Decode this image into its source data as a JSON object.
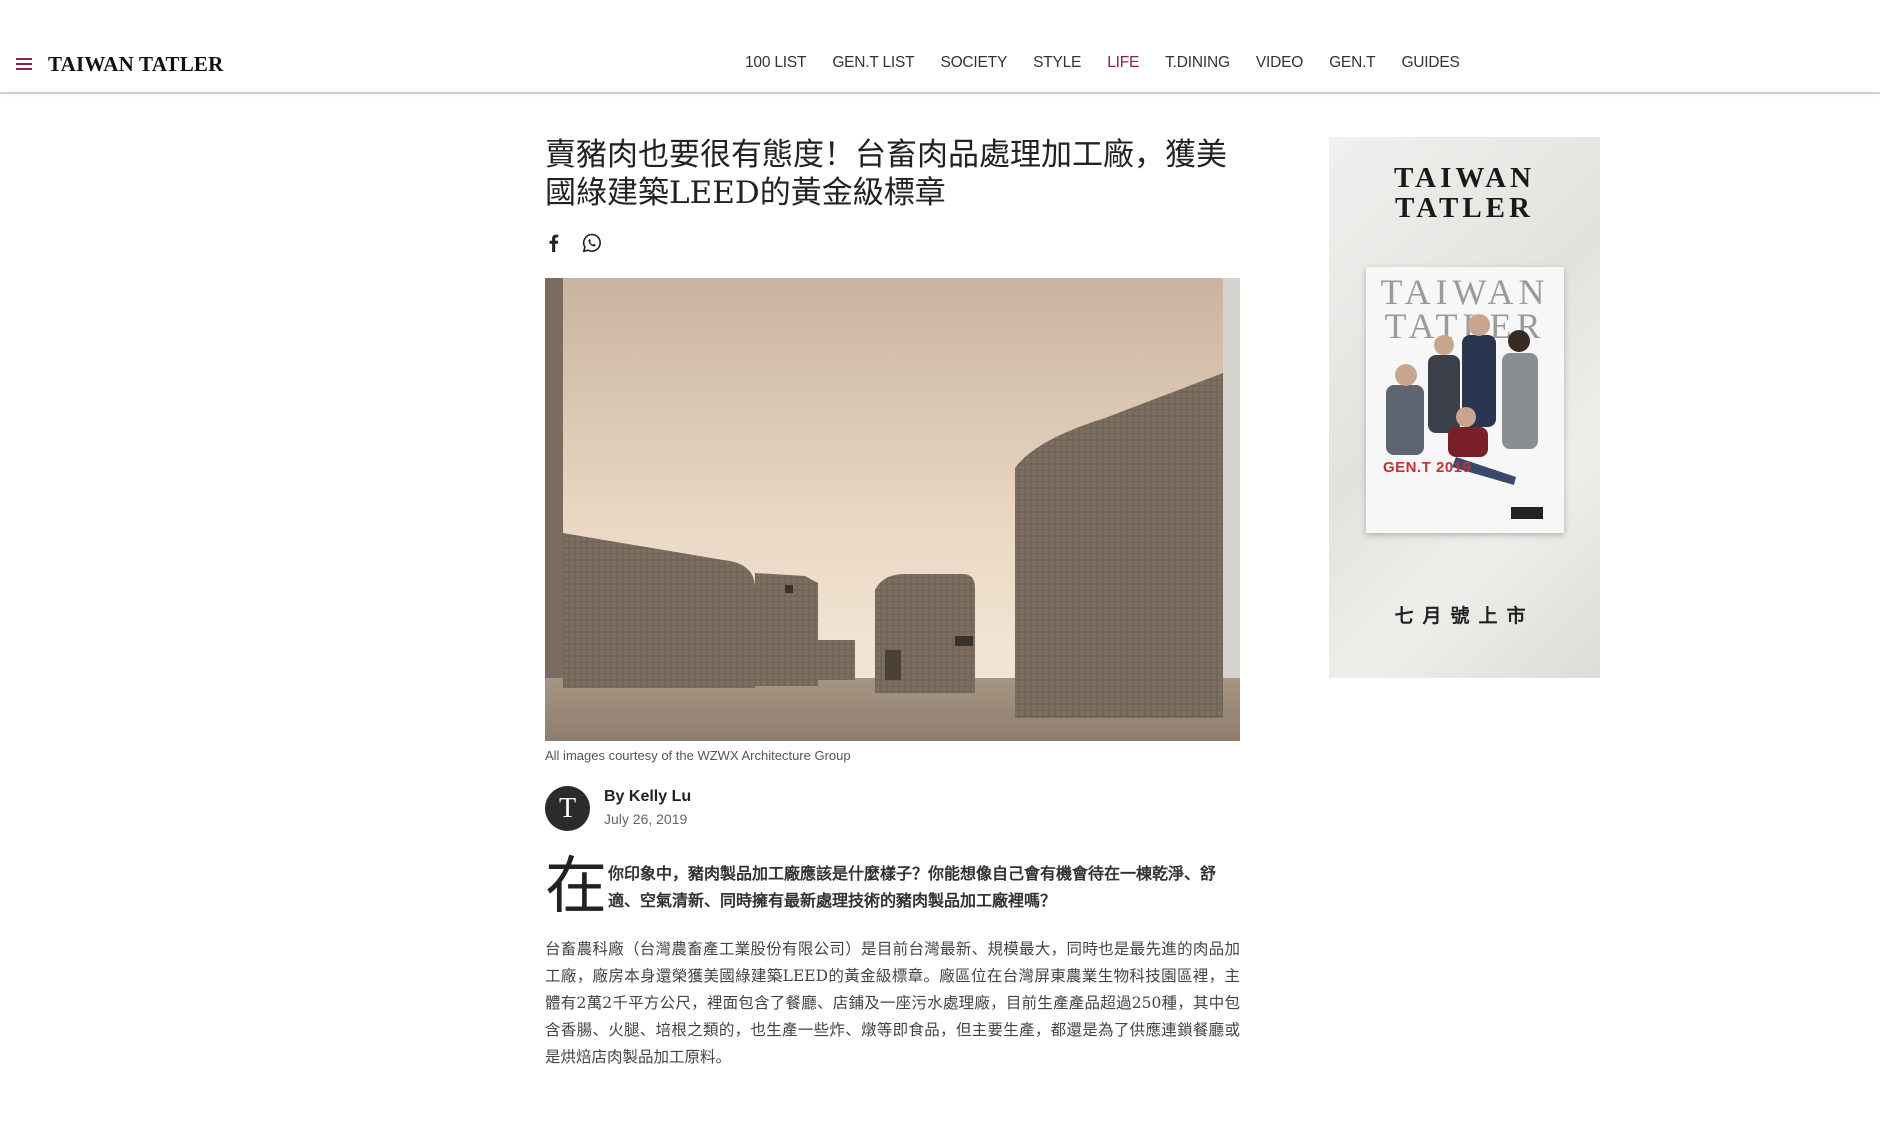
{
  "header": {
    "brand": "TAIWAN TATLER",
    "menu_icon": "hamburger-menu-icon",
    "accent_color": "#8b2140",
    "nav": [
      {
        "label": "100 LIST",
        "active": false
      },
      {
        "label": "GEN.T LIST",
        "active": false
      },
      {
        "label": "SOCIETY",
        "active": false
      },
      {
        "label": "STYLE",
        "active": false
      },
      {
        "label": "LIFE",
        "active": true
      },
      {
        "label": "T.DINING",
        "active": false
      },
      {
        "label": "VIDEO",
        "active": false
      },
      {
        "label": "GEN.T",
        "active": false
      },
      {
        "label": "GUIDES",
        "active": false
      }
    ]
  },
  "article": {
    "title": "賣豬肉也要很有態度！台畜肉品處理加工廠，獲美國綠建築LEED的黃金級標章",
    "share": {
      "facebook_icon": "facebook-icon",
      "whatsapp_icon": "whatsapp-icon"
    },
    "image_caption": "All images courtesy of the WZWX Architecture Group",
    "author": {
      "avatar_letter": "T",
      "byline": "By Kelly Lu",
      "date": "July 26, 2019"
    },
    "lead": {
      "dropcap": "在",
      "text": "你印象中，豬肉製品加工廠應該是什麼樣子？你能想像自己會有機會待在一棟乾淨、舒適、空氣清新、同時擁有最新處理技術的豬肉製品加工廠裡嗎？"
    },
    "body": "台畜農科廠（台灣農畜產工業股份有限公司）是目前台灣最新、規模最大，同時也是最先進的肉品加工廠，廠房本身還榮獲美國綠建築LEED的黃金級標章。廠區位在台灣屏東農業生物科技園區裡，主體有2萬2千平方公尺，裡面包含了餐廳、店鋪及一座污水處理廠，目前生產產品超過250種，其中包含香腸、火腿、培根之類的，也生產一些炸、燉等即食品，但主要生產，都還是為了供應連鎖餐廳或是烘焙店肉製品加工原料。"
  },
  "ad": {
    "brand_line1": "TAIWAN",
    "brand_line2": "TATLER",
    "cover_masthead_line1": "TAIWAN",
    "cover_masthead_line2": "TATLER",
    "cover_issue": "GEN.T 2019",
    "tagline": "七月號上市"
  }
}
